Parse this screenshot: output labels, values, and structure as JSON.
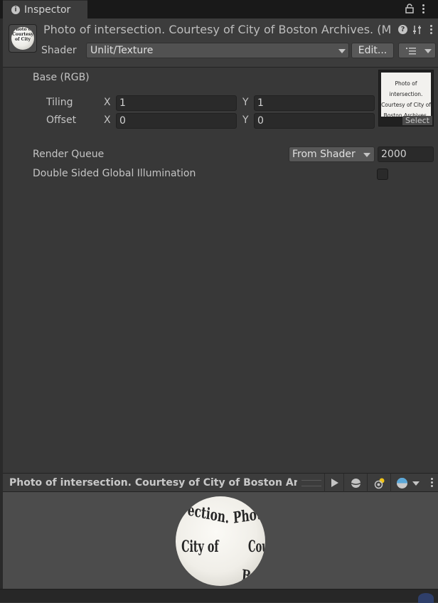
{
  "tab": {
    "title": "Inspector",
    "info_icon": "info-icon"
  },
  "header": {
    "material_title": "Photo of intersection. Courtesy of City of Boston Archives. (M",
    "thumb_text": "Photo of Courtesy of City",
    "shader_label": "Shader",
    "shader_value": "Unlit/Texture",
    "edit_label": "Edit...",
    "help_glyph": "?"
  },
  "properties": {
    "base_label": "Base (RGB)",
    "tiling_label": "Tiling",
    "offset_label": "Offset",
    "x_label": "X",
    "y_label": "Y",
    "tiling_x": "1",
    "tiling_y": "1",
    "offset_x": "0",
    "offset_y": "0",
    "texture_text_1": "Photo of intersection.",
    "texture_text_2": "Courtesy of City of",
    "texture_text_3": "Boston Archives.",
    "select_label": "Select",
    "render_queue_label": "Render Queue",
    "render_queue_mode": "From Shader",
    "render_queue_value": "2000",
    "dsgi_label": "Double Sided Global Illumination",
    "dsgi_checked": false
  },
  "preview": {
    "title": "Photo of intersection. Courtesy of City of Boston Archives. (Material)",
    "sphere_words": [
      "ection.",
      "Photo",
      "City of",
      "Court",
      "Bo"
    ]
  },
  "colors": {
    "background": "#383838",
    "panel": "#3c3c3c",
    "field": "#2a2a2a",
    "text": "#c4c4c4"
  }
}
